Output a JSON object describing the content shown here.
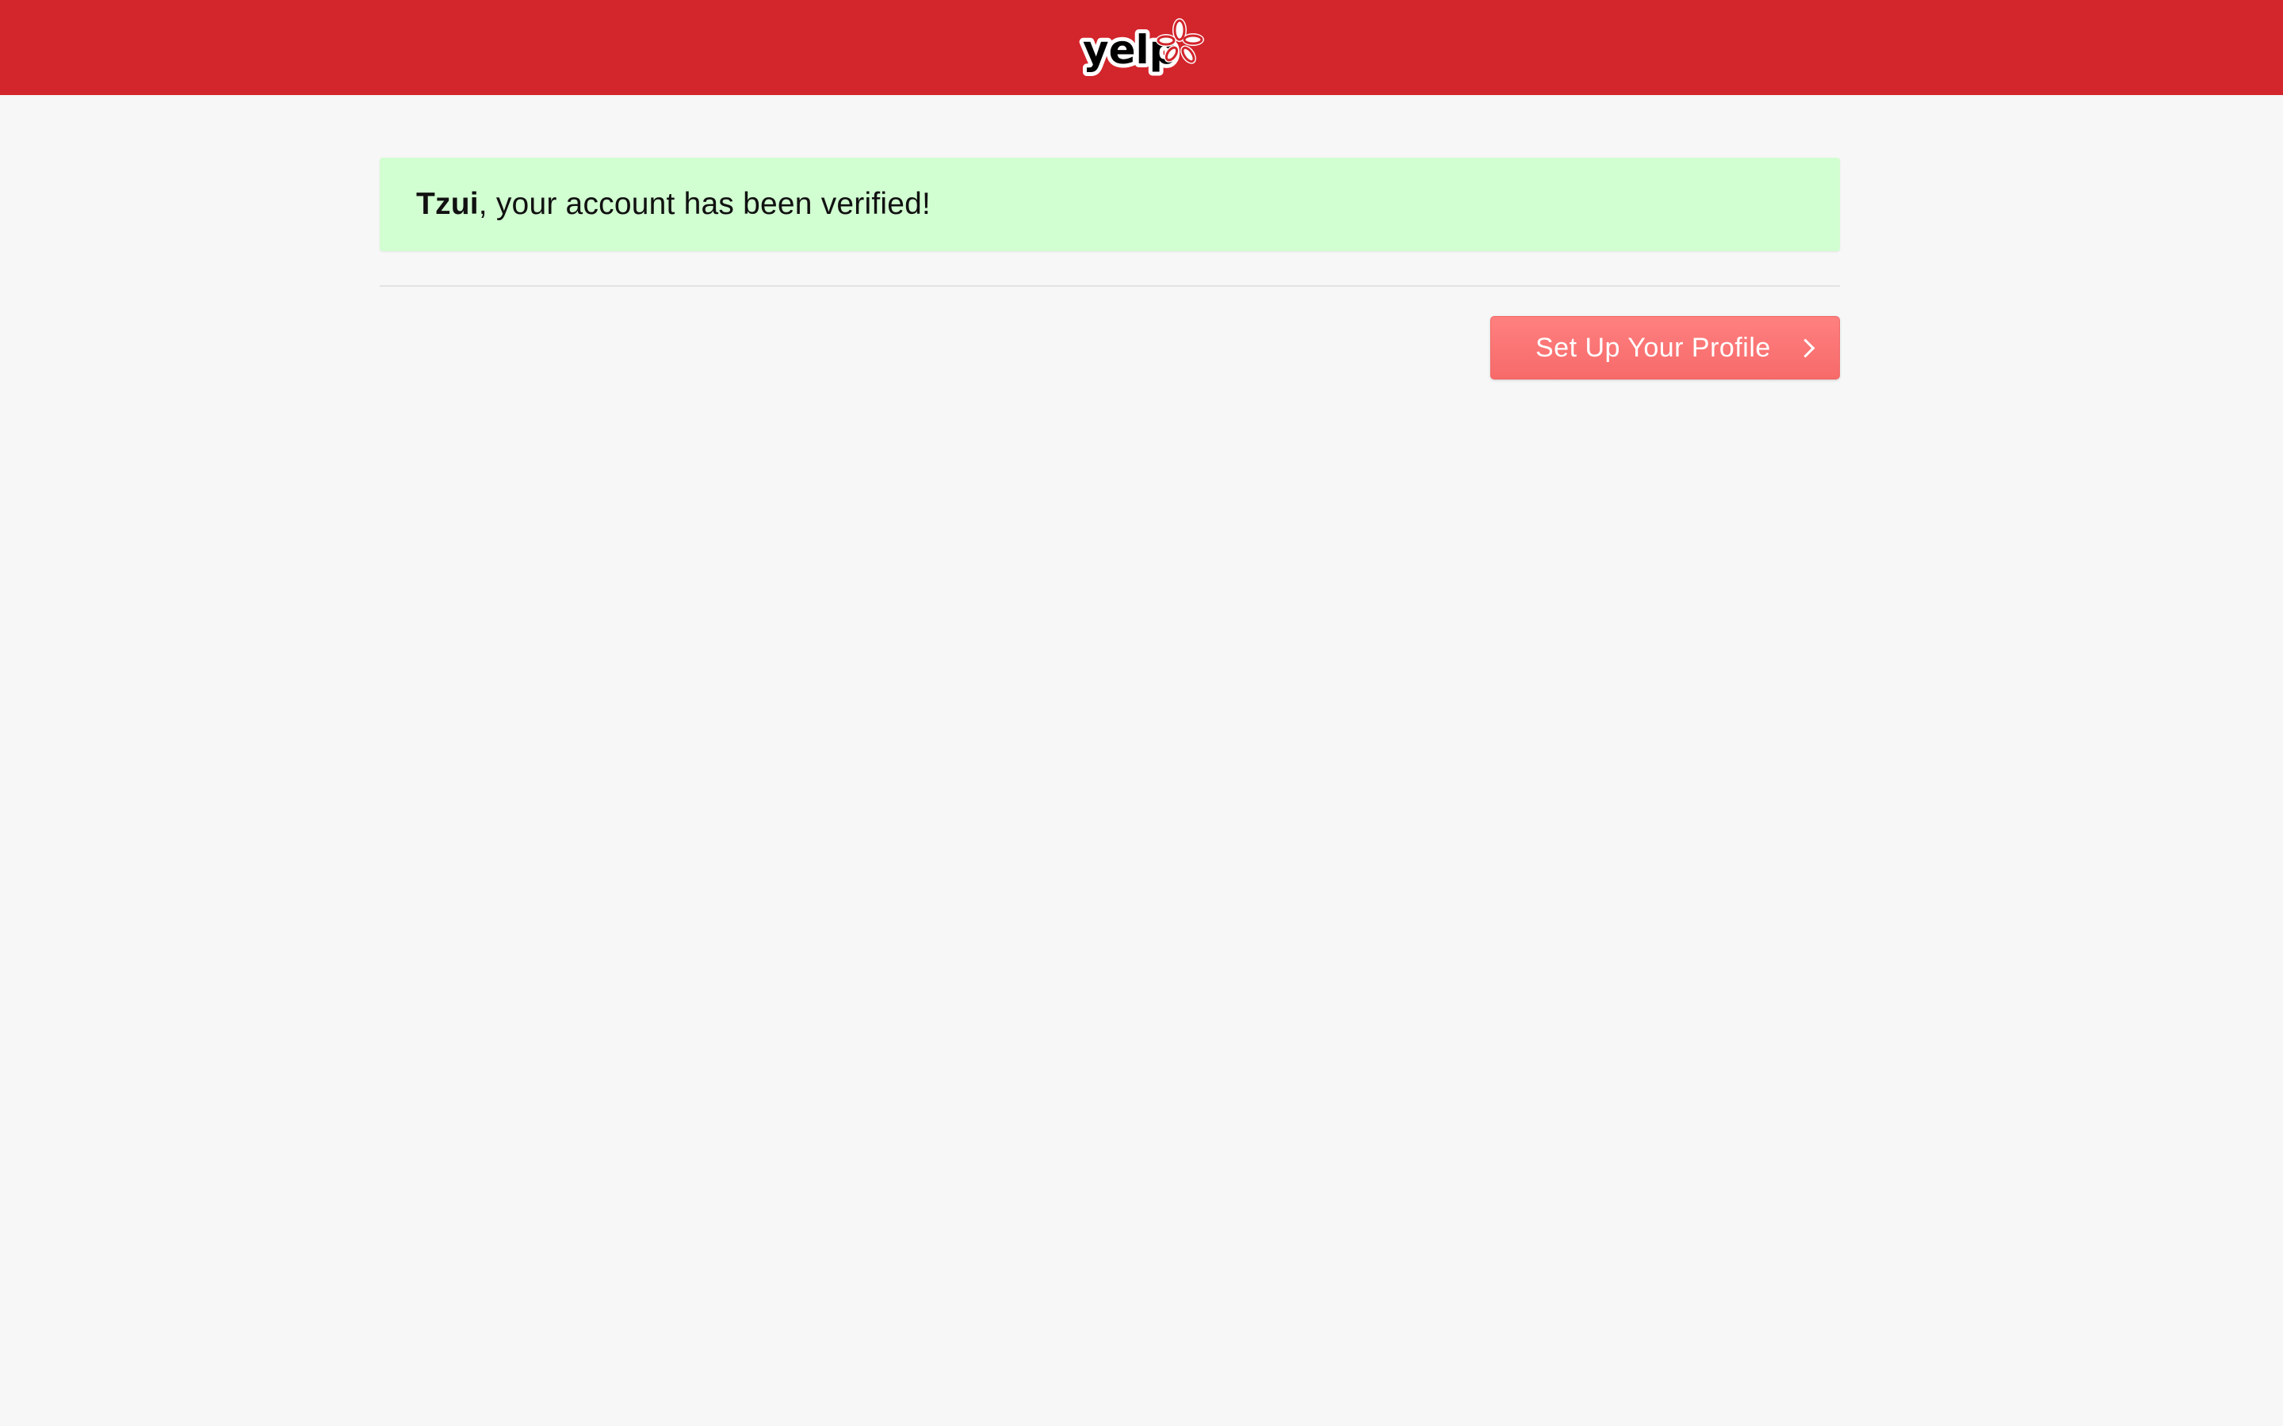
{
  "header": {
    "logo_text": "yelp",
    "brand_color": "#d3252c"
  },
  "alert": {
    "username": "Tzui",
    "message": ", your account has been verified!",
    "bg_color": "#d1ffd1"
  },
  "actions": {
    "setup_profile_label": "Set Up Your Profile",
    "setup_profile_icon": "chevron-right-icon",
    "button_color": "#ff7f7f"
  }
}
